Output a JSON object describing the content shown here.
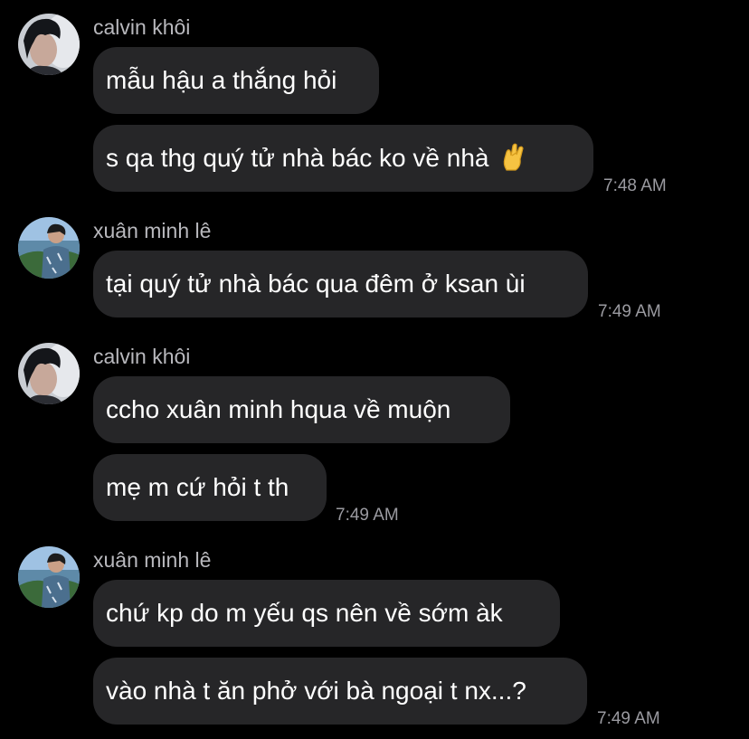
{
  "conversation": {
    "messages": [
      {
        "sender": "calvin khôi",
        "avatar": "calvin-avatar",
        "text": "mẫu hậu a thắng hỏi"
      },
      {
        "sender": "calvin khôi",
        "avatar": "calvin-avatar",
        "text": "s qa thg quý tử nhà bác ko về nhà",
        "emoji": "crossed-fingers-icon",
        "time": "7:48 AM"
      },
      {
        "sender": "xuân minh lê",
        "avatar": "xuan-avatar",
        "text": "tại quý tử nhà bác qua đêm ở ksan ùi",
        "time": "7:49 AM"
      },
      {
        "sender": "calvin khôi",
        "avatar": "calvin-avatar",
        "text": "ccho xuân minh hqua về muộn"
      },
      {
        "sender": "calvin khôi",
        "avatar": "calvin-avatar",
        "text": "mẹ m cứ hỏi t th",
        "time": "7:49 AM"
      },
      {
        "sender": "xuân minh lê",
        "avatar": "xuan-avatar",
        "text": "chứ kp do m yếu qs nên về sớm àk"
      },
      {
        "sender": "xuân minh lê",
        "avatar": "xuan-avatar",
        "text": "vào nhà t ăn phở với bà ngoại t nx...?",
        "time": "7:49 AM"
      }
    ]
  }
}
